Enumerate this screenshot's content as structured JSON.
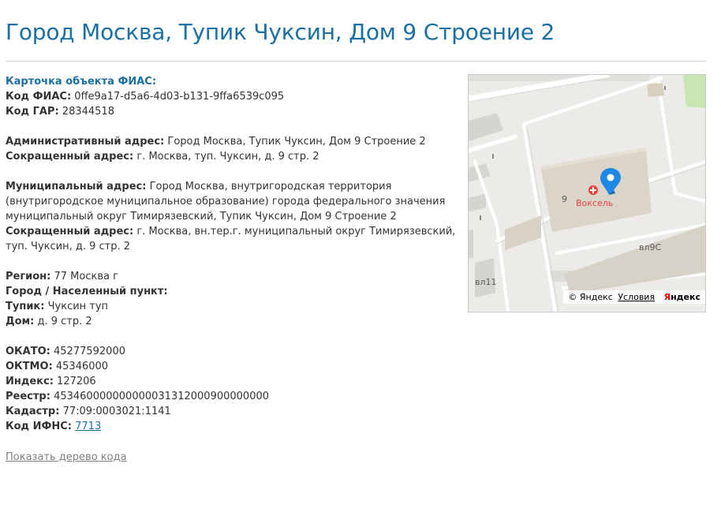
{
  "title": "Город Москва, Тупик Чуксин, Дом 9 Строение 2",
  "card_title": "Карточка объекта ФИАС:",
  "fias": {
    "label": "Код ФИАС:",
    "value": "0ffe9a17-d5a6-4d03-b131-9ffa6539c095"
  },
  "gar": {
    "label": "Код ГАР:",
    "value": "28344518"
  },
  "admin_address": {
    "label": "Административный адрес:",
    "value": "Город Москва, Тупик Чуксин, Дом 9 Строение 2"
  },
  "admin_short": {
    "label": "Сокращенный адрес:",
    "value": "г. Москва, туп. Чуксин, д. 9 стр. 2"
  },
  "mun_address": {
    "label": "Муниципальный адрес:",
    "value": "Город Москва, внутригородская территория (внутригородское муниципальное образование) города федерального значения муниципальный округ Тимирязевский, Тупик Чуксин, Дом 9 Строение 2"
  },
  "mun_short": {
    "label": "Сокращенный адрес:",
    "value": "г. Москва, вн.тер.г. муниципальный округ Тимирязевский, туп. Чуксин, д. 9 стр. 2"
  },
  "region": {
    "label": "Регион:",
    "value": "77 Москва г"
  },
  "city": {
    "label": "Город / Населенный пункт:",
    "value": ""
  },
  "street": {
    "label": "Тупик:",
    "value": "Чуксин туп"
  },
  "house": {
    "label": "Дом:",
    "value": "д. 9 стр. 2"
  },
  "okato": {
    "label": "ОКАТО:",
    "value": "45277592000"
  },
  "oktmo": {
    "label": "ОКТМО:",
    "value": "45346000"
  },
  "index": {
    "label": "Индекс:",
    "value": "127206"
  },
  "registry": {
    "label": "Реестр:",
    "value": "453460000000000031312000900000000"
  },
  "cadastre": {
    "label": "Кадастр:",
    "value": "77:09:0003021:1141"
  },
  "ifns": {
    "label": "Код ИФНС:",
    "value": "7713"
  },
  "show_tree_link": "Показать дерево кода",
  "map": {
    "labels": {
      "house_number": "9",
      "poi_name": "Воксель",
      "building_b": "вл9С",
      "building_c": "вл11"
    },
    "copyright": "© Яндекс",
    "terms": "Условия",
    "logo": "Яндекс",
    "colors": {
      "pin": "#1e88e5",
      "poi": "#e8423f",
      "park": "#c9e5b1"
    }
  }
}
